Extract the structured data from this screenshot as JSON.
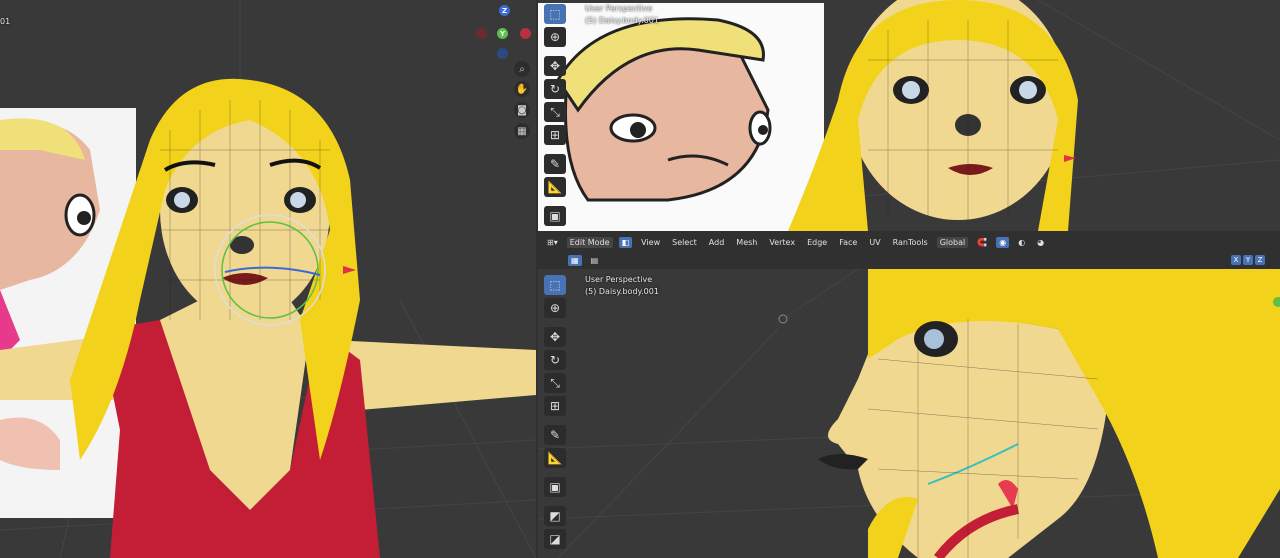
{
  "left_viewport": {
    "corner_text": "01"
  },
  "top_right_viewport": {
    "perspective_label": "User Perspective",
    "object_label": "(5) Daisy.body.001"
  },
  "bottom_viewport": {
    "perspective_label": "User Perspective",
    "object_label": "(5) Daisy.body.001"
  },
  "header": {
    "mode": "Edit Mode",
    "menus": [
      "View",
      "Select",
      "Add",
      "Mesh",
      "Vertex",
      "Edge",
      "Face",
      "UV",
      "RanTools"
    ],
    "transform_orientation": "Global",
    "axes": [
      "X",
      "Y",
      "Z"
    ]
  },
  "gizmo": {
    "z": "Z",
    "y": "Y"
  },
  "colors": {
    "hair": "#f2d21a",
    "skin": "#f0d890",
    "top": "#c41e36",
    "accent": "#4772b3",
    "background": "#393939"
  },
  "icons": [
    "select-box-icon",
    "cursor-icon",
    "move-icon",
    "rotate-icon",
    "scale-icon",
    "transform-icon",
    "annotate-icon",
    "measure-icon",
    "add-cube-icon",
    "zoom-icon",
    "hand-icon",
    "camera-icon",
    "grid-icon"
  ]
}
